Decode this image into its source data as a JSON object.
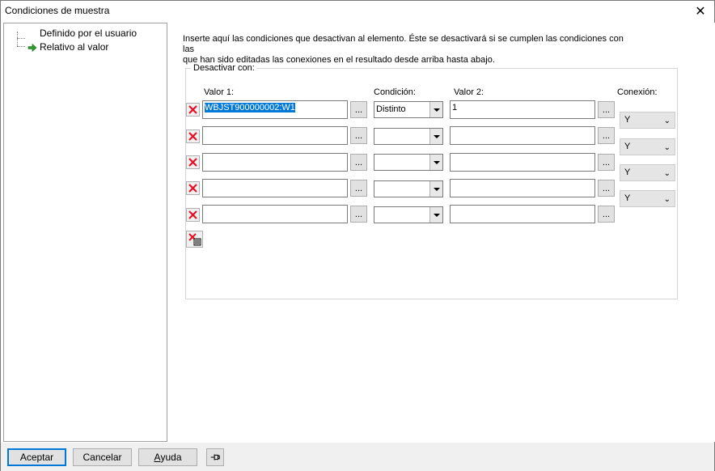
{
  "window": {
    "title": "Condiciones de muestra",
    "close_label": "✕"
  },
  "tree": {
    "items": [
      {
        "label": "Definido por el usuario",
        "selected": false
      },
      {
        "label": "Relativo al valor",
        "selected": true,
        "icon": "green-arrow-icon"
      }
    ]
  },
  "content": {
    "info_line1": "Inserte aquí las condiciones que desactivan al elemento. Éste se desactivará si se cumplen las condiciones con las",
    "info_line2": "que han sido editadas las conexiones en el resultado desde arriba hasta abajo.",
    "group_title": "Desactivar con:",
    "headers": {
      "valor1": "Valor 1:",
      "condicion": "Condición:",
      "valor2": "Valor 2:",
      "conexion": "Conexión:"
    },
    "dots_label": "...",
    "rows": [
      {
        "valor1": "WBJST900000002:W1",
        "condicion": "Distinto",
        "valor2": "1"
      },
      {
        "valor1": "",
        "condicion": "",
        "valor2": ""
      },
      {
        "valor1": "",
        "condicion": "",
        "valor2": ""
      },
      {
        "valor1": "",
        "condicion": "",
        "valor2": ""
      },
      {
        "valor1": "",
        "condicion": "",
        "valor2": ""
      }
    ],
    "connections": [
      "Y",
      "Y",
      "Y",
      "Y"
    ],
    "colors": {
      "delete_red": "#e81123",
      "selection": "#0078d7",
      "arrow_green": "#2e9b2e"
    }
  },
  "footer": {
    "accept": "Aceptar",
    "cancel": "Cancelar",
    "help_u": "A",
    "help_rest": "yuda"
  }
}
